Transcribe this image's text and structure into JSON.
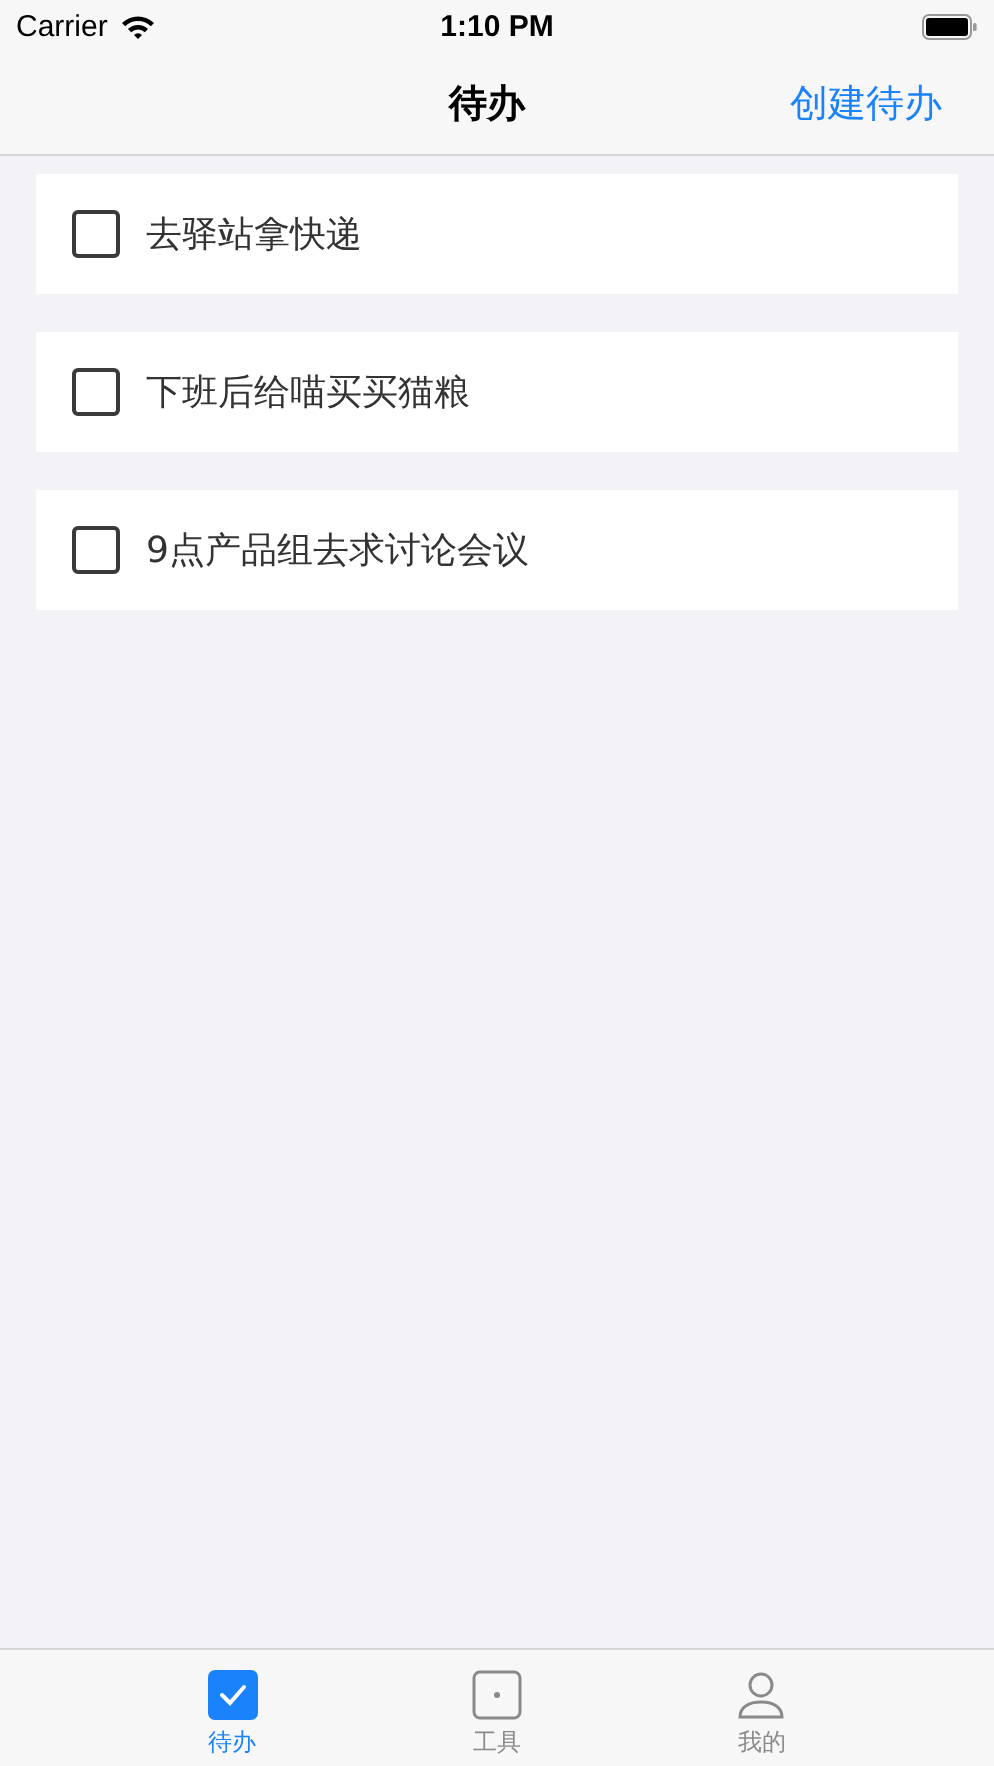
{
  "status_bar": {
    "carrier": "Carrier",
    "time": "1:10 PM"
  },
  "nav_bar": {
    "title": "待办",
    "action": "创建待办"
  },
  "todos": [
    {
      "text": "去驿站拿快递",
      "checked": false
    },
    {
      "text": "下班后给喵买买猫粮",
      "checked": false
    },
    {
      "text": "9点产品组去求讨论会议",
      "checked": false
    }
  ],
  "tab_bar": [
    {
      "label": "待办",
      "selected": true
    },
    {
      "label": "工具",
      "selected": false
    },
    {
      "label": "我的",
      "selected": false
    }
  ]
}
